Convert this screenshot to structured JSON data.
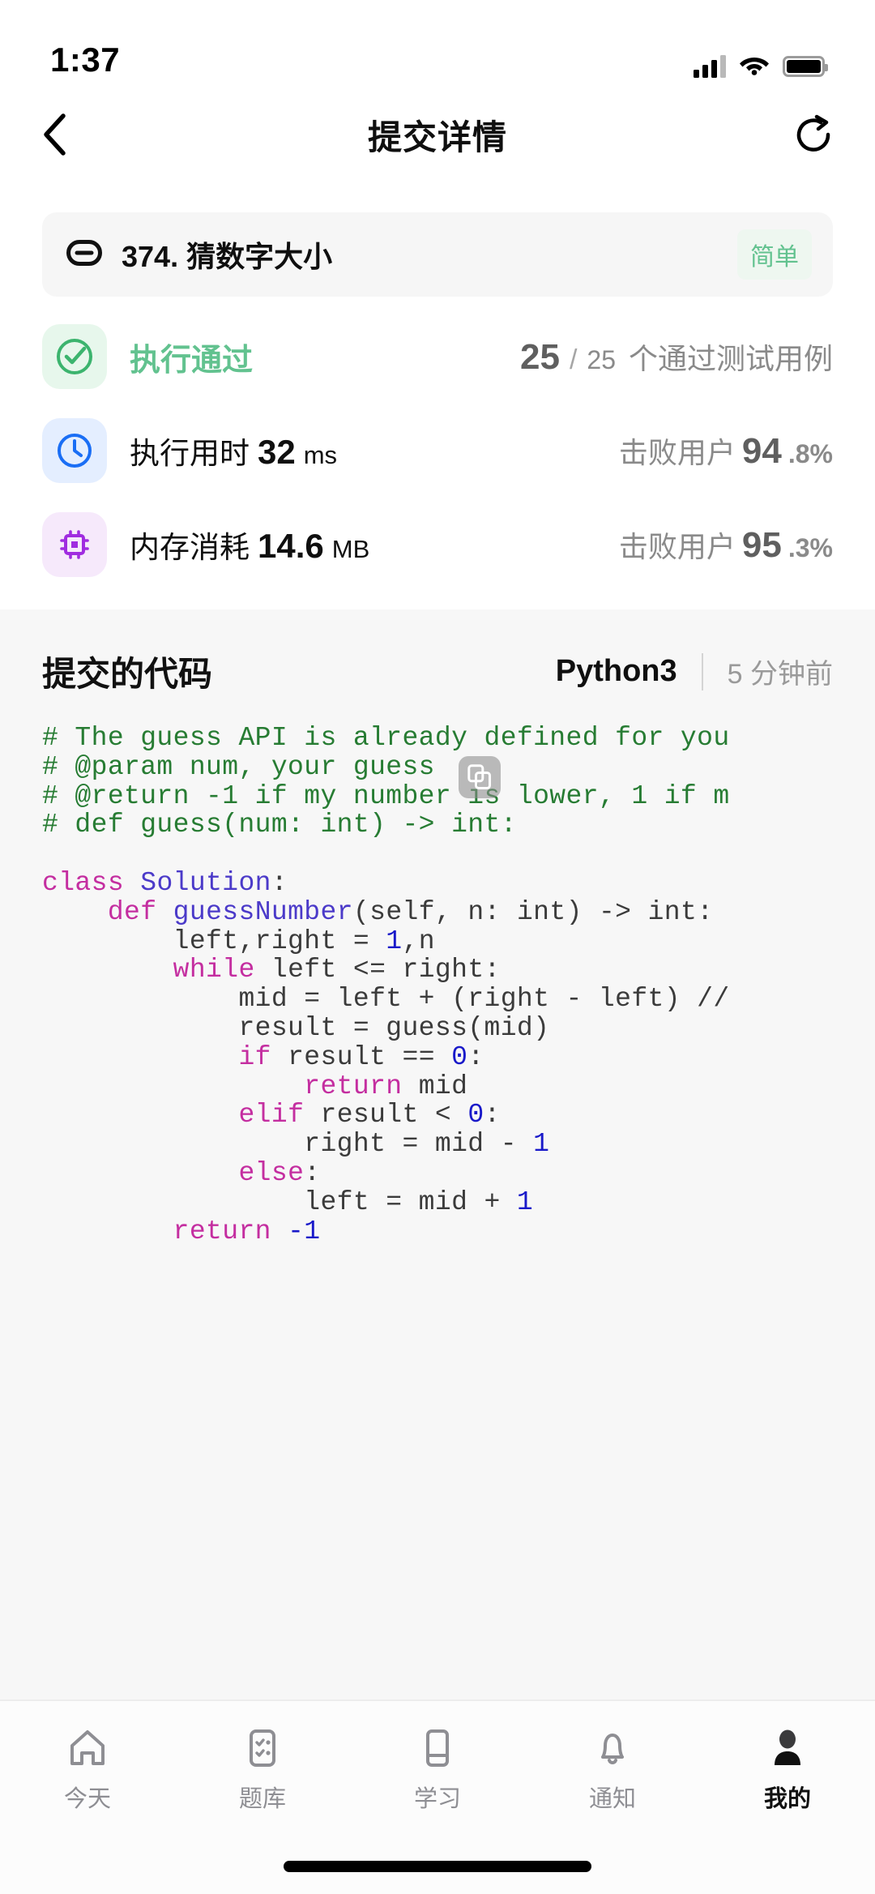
{
  "status_bar": {
    "time": "1:37",
    "signal_icon": "cellular-signal-icon",
    "wifi_icon": "wifi-icon",
    "battery_icon": "battery-icon"
  },
  "header": {
    "back_icon": "chevron-left-icon",
    "title": "提交详情",
    "share_icon": "share-rotate-icon"
  },
  "problem": {
    "link_icon": "link-icon",
    "title": "374. 猜数字大小",
    "difficulty": "简单",
    "difficulty_color": "#62c28f",
    "difficulty_bg": "#eef7f0"
  },
  "result": {
    "status_icon": "check-circle-icon",
    "status_label": "执行通过",
    "status_color": "#62c28f",
    "cases_passed": "25",
    "cases_separator": "/",
    "cases_total": "25",
    "cases_text": "个通过测试用例"
  },
  "runtime": {
    "icon": "clock-icon",
    "icon_color": "#1a6ef5",
    "label": "执行用时",
    "value": "32",
    "unit": "ms",
    "beats_label": "击败用户",
    "beats_value": "94",
    "beats_decimal": ".8%"
  },
  "memory": {
    "icon": "chip-icon",
    "icon_color": "#a02ce0",
    "label": "内存消耗",
    "value": "14.6",
    "unit": "MB",
    "beats_label": "击败用户",
    "beats_value": "95",
    "beats_decimal": ".3%"
  },
  "code_section": {
    "title": "提交的代码",
    "language": "Python3",
    "time_ago": "5 分钟前",
    "copy_icon": "copy-icon",
    "lines": [
      {
        "indent": 0,
        "tokens": [
          {
            "t": "# The guess API is already defined for you",
            "c": "comment"
          }
        ]
      },
      {
        "indent": 0,
        "tokens": [
          {
            "t": "# @param num, your guess",
            "c": "comment"
          }
        ]
      },
      {
        "indent": 0,
        "tokens": [
          {
            "t": "# @return -1 if my number is lower, 1 if m",
            "c": "comment"
          }
        ]
      },
      {
        "indent": 0,
        "tokens": [
          {
            "t": "# def guess(num: int) -> int:",
            "c": "comment"
          }
        ]
      },
      {
        "indent": 0,
        "tokens": []
      },
      {
        "indent": 0,
        "tokens": [
          {
            "t": "class",
            "c": "kw"
          },
          {
            "t": " ",
            "c": "plain"
          },
          {
            "t": "Solution",
            "c": "fn"
          },
          {
            "t": ":",
            "c": "plain"
          }
        ]
      },
      {
        "indent": 0,
        "tokens": [
          {
            "t": "    ",
            "c": "plain"
          },
          {
            "t": "def",
            "c": "kw"
          },
          {
            "t": " ",
            "c": "plain"
          },
          {
            "t": "guessNumber",
            "c": "fn"
          },
          {
            "t": "(self, n: int) -> int:",
            "c": "plain"
          }
        ]
      },
      {
        "indent": 0,
        "tokens": [
          {
            "t": "        left,right = ",
            "c": "plain"
          },
          {
            "t": "1",
            "c": "num"
          },
          {
            "t": ",n",
            "c": "plain"
          }
        ]
      },
      {
        "indent": 0,
        "tokens": [
          {
            "t": "        ",
            "c": "plain"
          },
          {
            "t": "while",
            "c": "kw"
          },
          {
            "t": " left <= right:",
            "c": "plain"
          }
        ]
      },
      {
        "indent": 0,
        "tokens": [
          {
            "t": "            mid = left + (right - left) //",
            "c": "plain"
          }
        ]
      },
      {
        "indent": 0,
        "tokens": [
          {
            "t": "            result = guess(mid)",
            "c": "plain"
          }
        ]
      },
      {
        "indent": 0,
        "tokens": [
          {
            "t": "            ",
            "c": "plain"
          },
          {
            "t": "if",
            "c": "kw"
          },
          {
            "t": " result == ",
            "c": "plain"
          },
          {
            "t": "0",
            "c": "num"
          },
          {
            "t": ":",
            "c": "plain"
          }
        ]
      },
      {
        "indent": 0,
        "tokens": [
          {
            "t": "                ",
            "c": "plain"
          },
          {
            "t": "return",
            "c": "kw"
          },
          {
            "t": " mid",
            "c": "plain"
          }
        ]
      },
      {
        "indent": 0,
        "tokens": [
          {
            "t": "            ",
            "c": "plain"
          },
          {
            "t": "elif",
            "c": "kw"
          },
          {
            "t": " result < ",
            "c": "plain"
          },
          {
            "t": "0",
            "c": "num"
          },
          {
            "t": ":",
            "c": "plain"
          }
        ]
      },
      {
        "indent": 0,
        "tokens": [
          {
            "t": "                right = mid - ",
            "c": "plain"
          },
          {
            "t": "1",
            "c": "num"
          }
        ]
      },
      {
        "indent": 0,
        "tokens": [
          {
            "t": "            ",
            "c": "plain"
          },
          {
            "t": "else",
            "c": "kw"
          },
          {
            "t": ":",
            "c": "plain"
          }
        ]
      },
      {
        "indent": 0,
        "tokens": [
          {
            "t": "                left = mid + ",
            "c": "plain"
          },
          {
            "t": "1",
            "c": "num"
          }
        ]
      },
      {
        "indent": 0,
        "tokens": [
          {
            "t": "        ",
            "c": "plain"
          },
          {
            "t": "return",
            "c": "kw"
          },
          {
            "t": " ",
            "c": "plain"
          },
          {
            "t": "-1",
            "c": "num"
          }
        ]
      }
    ],
    "syntax_colors": {
      "comment": "#277c33",
      "keyword": "#c42ea0",
      "function": "#4b3ac9",
      "number": "#1919c9",
      "plain": "#3b3b3b"
    }
  },
  "tabbar": {
    "items": [
      {
        "label": "今天",
        "icon": "home-icon",
        "active": false
      },
      {
        "label": "题库",
        "icon": "clipboard-list-icon",
        "active": false
      },
      {
        "label": "学习",
        "icon": "book-icon",
        "active": false
      },
      {
        "label": "通知",
        "icon": "bell-icon",
        "active": false
      },
      {
        "label": "我的",
        "icon": "person-icon",
        "active": true
      }
    ]
  }
}
